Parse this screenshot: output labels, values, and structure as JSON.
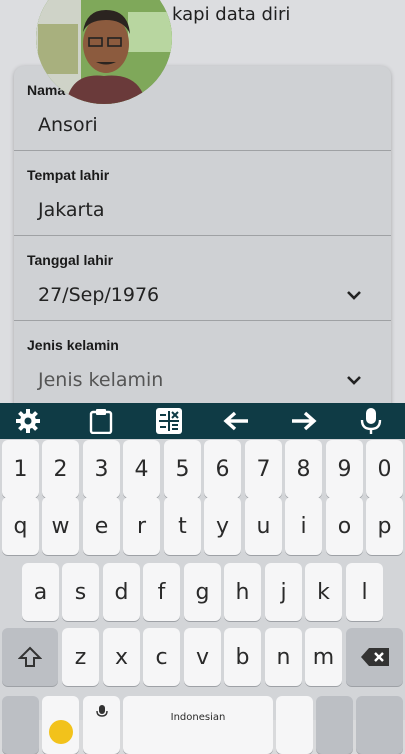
{
  "header": {
    "title_fragment": "kapi data diri"
  },
  "form": {
    "fields": [
      {
        "label": "Nama",
        "value": "Ansori"
      },
      {
        "label": "Tempat lahir",
        "value": "Jakarta"
      },
      {
        "label": "Tanggal lahir",
        "value": "27/Sep/1976"
      },
      {
        "label": "Jenis kelamin",
        "placeholder": "Jenis kelamin"
      }
    ]
  },
  "keyboard": {
    "toolbar_icons": [
      "gear-icon",
      "clipboard-icon",
      "calculator-icon",
      "arrow-left-icon",
      "arrow-right-icon",
      "microphone-icon"
    ],
    "row_numbers": [
      "1",
      "2",
      "3",
      "4",
      "5",
      "6",
      "7",
      "8",
      "9",
      "0"
    ],
    "row_top": [
      "q",
      "w",
      "e",
      "r",
      "t",
      "y",
      "u",
      "i",
      "o",
      "p"
    ],
    "row_middle": [
      "a",
      "s",
      "d",
      "f",
      "g",
      "h",
      "j",
      "k",
      "l"
    ],
    "row_bottom": [
      "z",
      "x",
      "c",
      "v",
      "b",
      "n",
      "m"
    ],
    "space_label": "Indonesian",
    "colors": {
      "toolbar": "#0f3b45",
      "key": "#f6f6f7",
      "background": "#d3d5d8"
    }
  }
}
